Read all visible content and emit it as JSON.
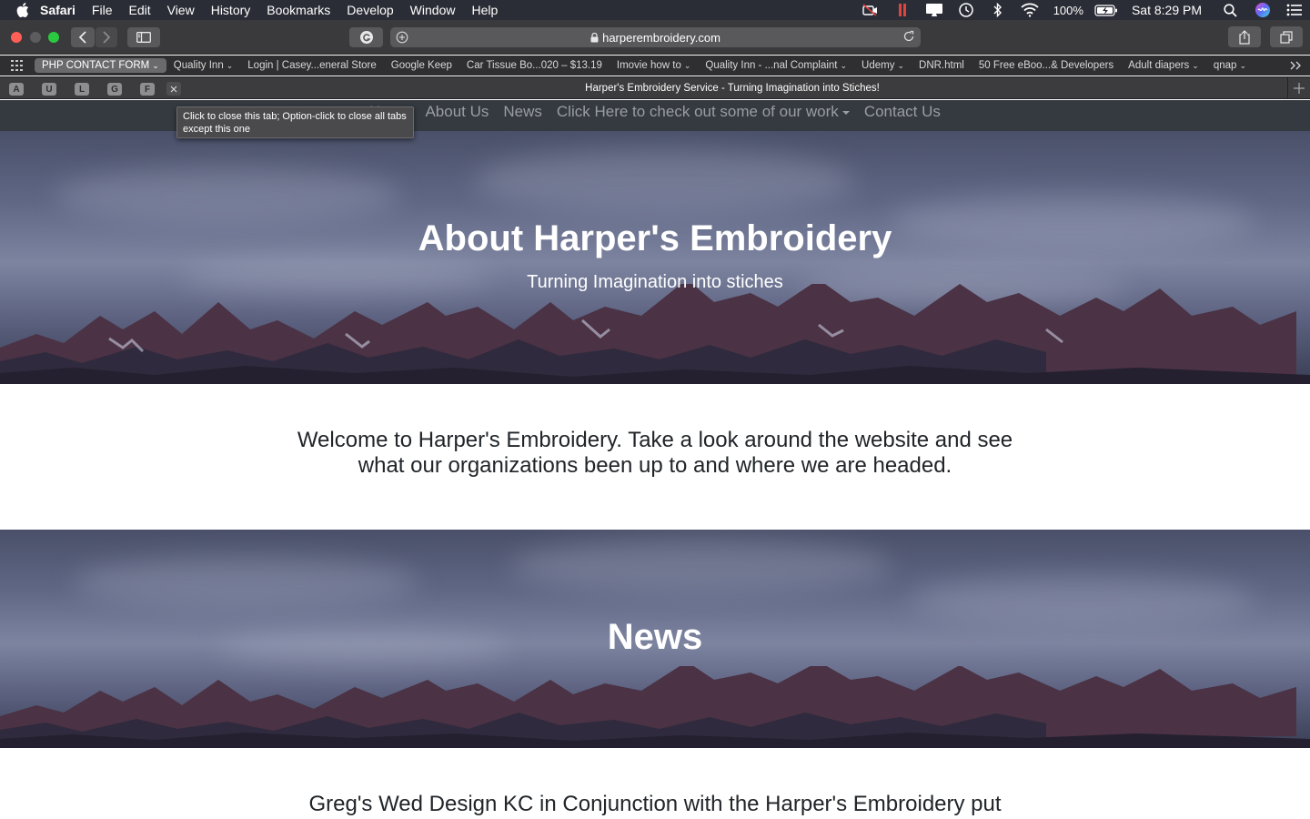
{
  "menubar": {
    "app": "Safari",
    "items": [
      "File",
      "Edit",
      "View",
      "History",
      "Bookmarks",
      "Develop",
      "Window",
      "Help"
    ],
    "battery": "100%",
    "clock": "Sat 8:29 PM"
  },
  "toolbar": {
    "url": "harperembroidery.com"
  },
  "favorites": {
    "items": [
      {
        "label": "PHP CONTACT FORM",
        "dropdown": true
      },
      {
        "label": "Quality Inn",
        "dropdown": true
      },
      {
        "label": "Login | Casey...eneral Store",
        "dropdown": false
      },
      {
        "label": "Google Keep",
        "dropdown": false
      },
      {
        "label": "Car Tissue Bo...020 – $13.19",
        "dropdown": false
      },
      {
        "label": "Imovie how to",
        "dropdown": true
      },
      {
        "label": "Quality Inn - ...nal Complaint",
        "dropdown": true
      },
      {
        "label": "Udemy",
        "dropdown": true
      },
      {
        "label": "DNR.html",
        "dropdown": false
      },
      {
        "label": "50 Free eBoo...& Developers",
        "dropdown": false
      },
      {
        "label": "Adult diapers",
        "dropdown": true
      },
      {
        "label": "qnap",
        "dropdown": true
      }
    ]
  },
  "tabs": {
    "pinned": [
      "A",
      "U",
      "L",
      "G",
      "F"
    ],
    "active_title": "Harper's Embroidery Service - Turning Imagination into Stiches!"
  },
  "tooltip": {
    "text": "Click to close this tab; Option-click to close all tabs except this one"
  },
  "nav": {
    "home": "Home",
    "about": "About Us",
    "news": "News",
    "work": "Click Here to check out some of our work",
    "contact": "Contact Us"
  },
  "hero": {
    "title": "About Harper's Embroidery",
    "subtitle": "Turning Imagination into stiches"
  },
  "welcome": {
    "text": "Welcome to Harper's Embroidery. Take a look around the website and see what our organizations been up to and where we are headed."
  },
  "news": {
    "title": "News",
    "text": "Greg's Wed Design KC in Conjunction with the Harper's Embroidery put"
  }
}
